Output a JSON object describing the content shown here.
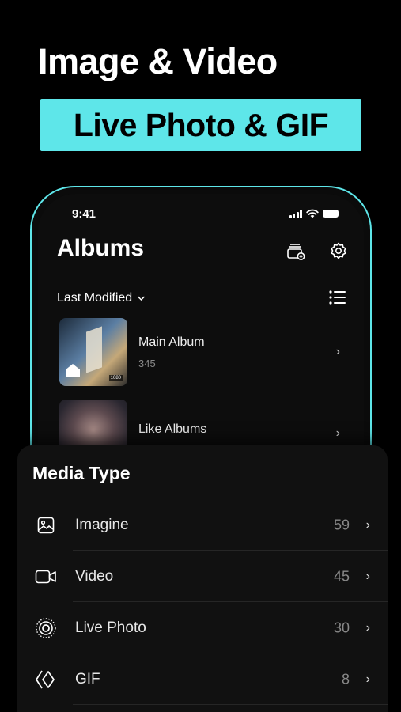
{
  "headline": "Image & Video",
  "highlight": "Live Photo & GIF",
  "colors": {
    "accent": "#5ee6e9",
    "background": "#000000",
    "sheet": "#111111"
  },
  "phone": {
    "status_time": "9:41",
    "title": "Albums",
    "icons": [
      "add-album-icon",
      "gear-icon",
      "list-view-icon"
    ],
    "sort_label": "Last Modified",
    "albums": [
      {
        "name": "Main Album",
        "count": "345"
      },
      {
        "name": "Like Albums",
        "count": ""
      }
    ]
  },
  "media_type": {
    "title": "Media Type",
    "items": [
      {
        "label": "Imagine",
        "count": "59",
        "icon": "image-icon"
      },
      {
        "label": "Video",
        "count": "45",
        "icon": "video-icon"
      },
      {
        "label": "Live Photo",
        "count": "30",
        "icon": "live-photo-icon"
      },
      {
        "label": "GIF",
        "count": "8",
        "icon": "gif-icon"
      }
    ]
  }
}
